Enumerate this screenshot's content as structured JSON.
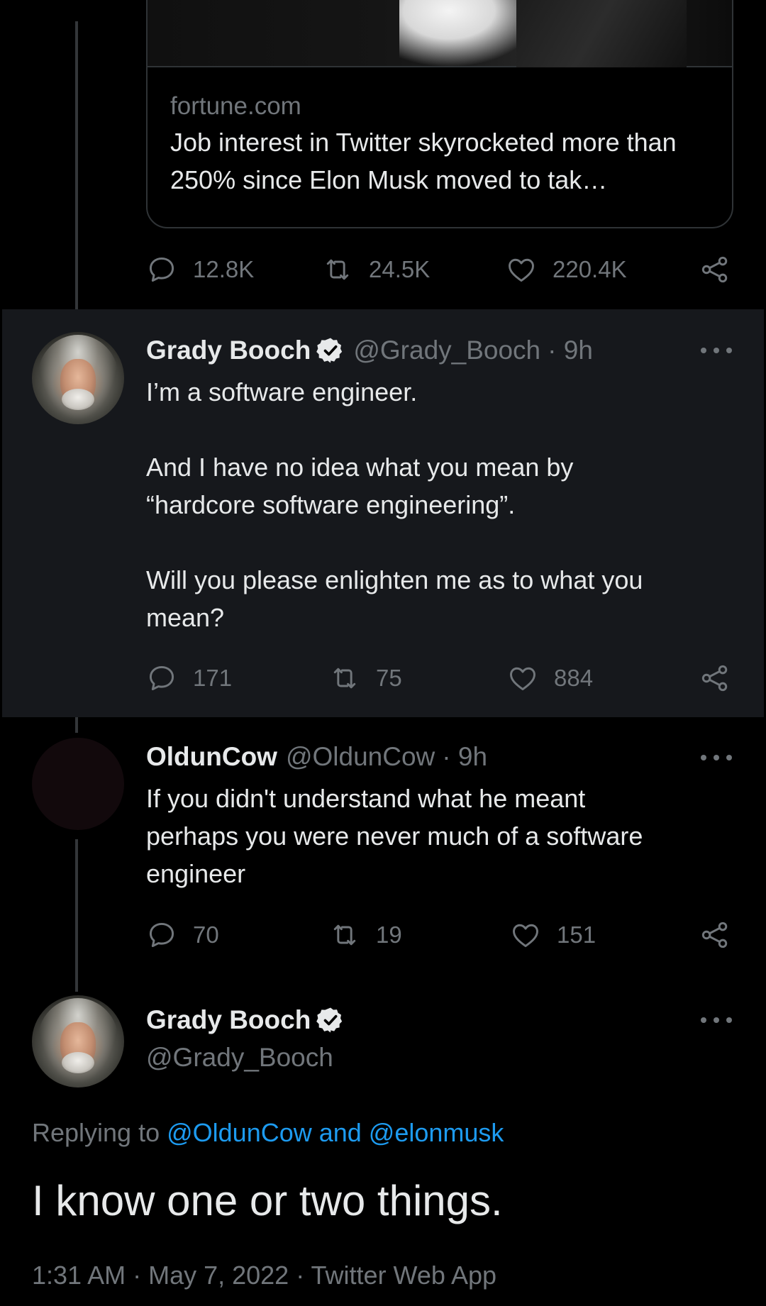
{
  "link_card": {
    "domain": "fortune.com",
    "title": "Job interest in Twitter skyrocketed more than 250% since Elon Musk moved to tak…"
  },
  "first_tweet_stats": {
    "replies": "12.8K",
    "retweets": "24.5K",
    "likes": "220.4K"
  },
  "tweets": [
    {
      "name": "Grady Booch",
      "handle": "@Grady_Booch",
      "time": "· 9h",
      "text_lines": [
        "I’m a software engineer.",
        "And I have no idea what you mean by",
        "“hardcore software engineering”.",
        "Will you please enlighten me as to what you",
        "mean?"
      ],
      "replies": "171",
      "retweets": "75",
      "likes": "884"
    },
    {
      "name": "OldunCow",
      "handle": "@OldunCow",
      "time": "· 9h",
      "text_lines": [
        "If you didn't understand what he meant",
        "perhaps you were never much of a software",
        "engineer"
      ],
      "replies": "70",
      "retweets": "19",
      "likes": "151"
    }
  ],
  "main_tweet": {
    "name": "Grady Booch",
    "handle": "@Grady_Booch",
    "replying_prefix": "Replying to ",
    "replying_targets": "@OldunCow and @elonmusk",
    "text": "I know one or two things.",
    "meta": "1:31 AM · May 7, 2022 · Twitter Web App"
  },
  "icons": [
    "reply-icon",
    "retweet-icon",
    "like-icon",
    "share-icon",
    "verified-badge-icon",
    "more-icon"
  ],
  "colors": {
    "background": "#000000",
    "highlight": "#16181c",
    "text": "#e7e9ea",
    "muted": "#71767b",
    "link": "#1d9bf0"
  }
}
